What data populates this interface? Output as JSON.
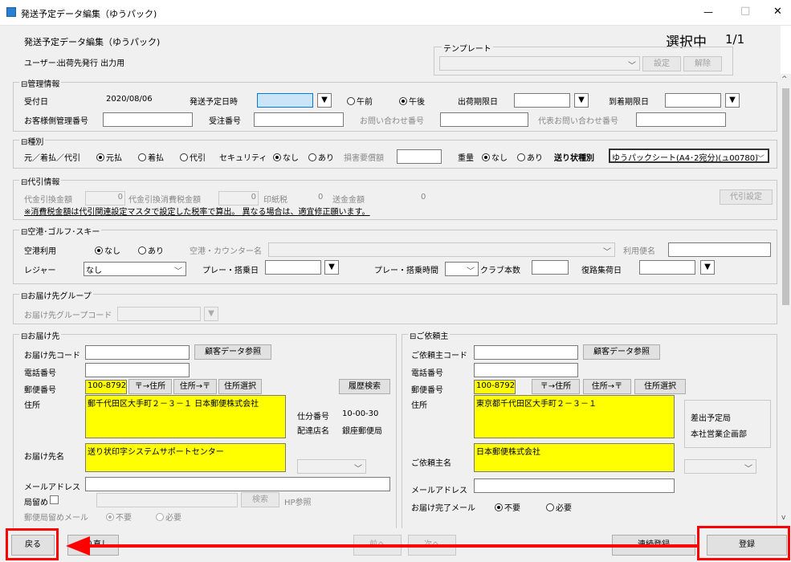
{
  "window": {
    "title": "発送予定データ編集（ゆうパック)",
    "min": "—",
    "max": "□",
    "close": "✕"
  },
  "header": {
    "heading": "発送予定データ編集（ゆうパック)",
    "user_label": "ユーザー:",
    "user_value": "出荷先発行 出力用",
    "selection": "選択中",
    "page": "1/1",
    "template_label": "テンプレート",
    "template_set": "設定",
    "template_clear": "解除"
  },
  "kanri": {
    "title": "管理情報",
    "uketsuke_label": "受付日",
    "uketsuke_value": "2020/08/06",
    "hassou_label": "発送予定日時",
    "gozen": "午前",
    "gogo": "午後",
    "shukka_label": "出荷期限日",
    "touchaku_label": "到着期限日",
    "kanri_no_label": "お客様側管理番号",
    "juchu_label": "受注番号",
    "toiawase_label": "お問い合わせ番号",
    "daihyo_label": "代表お問い合わせ番号"
  },
  "shubetsu": {
    "title": "種別",
    "moto_label": "元／着払／代引",
    "motoharai": "元払",
    "chakubarai": "着払",
    "daibiki": "代引",
    "security_label": "セキュリティ",
    "nashi": "なし",
    "ari": "あり",
    "songai_label": "損害要償額",
    "juryo_label": "重量",
    "okurijo_label": "送り状種別",
    "okurijo_value": "ゆうパックシート(A4･2宛分)(ュ00780)"
  },
  "daibiki": {
    "title": "代引情報",
    "kingaku_label": "代金引換金額",
    "kingaku_value": "0",
    "shohizei_label": "代金引換消費税金額",
    "shohizei_value": "0",
    "inshi_label": "印紙税",
    "inshi_value": "0",
    "sokin_label": "送金金額",
    "sokin_value": "0",
    "note": "※消費税金額は代引関連設定マスタで設定した税率で算出。 異なる場合は、適宜修正願います。",
    "settei": "代引設定"
  },
  "kuko": {
    "title": "空港･ゴルフ･スキー",
    "kuko_label": "空港利用",
    "nashi": "なし",
    "ari": "あり",
    "counter_label": "空港・カウンター名",
    "riyobin_label": "利用便名",
    "leisure_label": "レジャー",
    "leisure_value": "なし",
    "play_date_label": "プレー・搭乗日",
    "play_time_label": "プレー・搭乗時間",
    "club_label": "クラブ本数",
    "fukuro_label": "復路集荷日"
  },
  "group": {
    "title": "お届け先グループ",
    "code_label": "お届け先グループコード"
  },
  "todoke": {
    "title": "お届け先",
    "code_label": "お届け先コード",
    "kokyaku_btn": "顧客データ参照",
    "tel_label": "電話番号",
    "yubin_label": "郵便番号",
    "yubin_value": "100-8792",
    "btn_to_addr": "〒→住所",
    "btn_to_zip": "住所→〒",
    "btn_select": "住所選択",
    "btn_history": "履歴検索",
    "addr_label": "住所",
    "addr_value": "郵千代田区大手町２－３－１ 日本郵便株式会社",
    "shiwake_label": "仕分番号",
    "shiwake_value": "10-00-30",
    "haitatsu_label": "配達店名",
    "haitatsu_value": "銀座郵便局",
    "name_label": "お届け先名",
    "name_value": "送り状印字システムサポートセンター",
    "mail_label": "メールアドレス",
    "kyokudome_label": "局留め",
    "search_btn": "検索",
    "hp_label": "HP参照",
    "tome_mail_label": "郵便局留めメール",
    "fuyo": "不要",
    "hitsuyo": "必要"
  },
  "irai": {
    "title": "ご依頼主",
    "code_label": "ご依頼主コード",
    "kokyaku_btn": "顧客データ参照",
    "tel_label": "電話番号",
    "yubin_label": "郵便番号",
    "yubin_value": "100-8792",
    "btn_to_addr": "〒→住所",
    "btn_to_zip": "住所→〒",
    "btn_select": "住所選択",
    "addr_label": "住所",
    "addr_value": "東京都千代田区大手町２－３－１",
    "sashidashi_label": "差出予定局",
    "sashidashi_value": "本社営業企画部",
    "name_label": "ご依頼主名",
    "name_value": "日本郵便株式会社",
    "mail_label": "メールアドレス",
    "kanryo_label": "お届け完了メール",
    "fuyo": "不要",
    "hitsuyo": "必要"
  },
  "footer": {
    "back": "戻る",
    "redo": "やり直し",
    "prev": "前へ",
    "next": "次へ",
    "renzoku": "連続登録",
    "register": "登録"
  },
  "colors": {
    "highlight": "#ffff00",
    "annotation": "#ff0000"
  }
}
